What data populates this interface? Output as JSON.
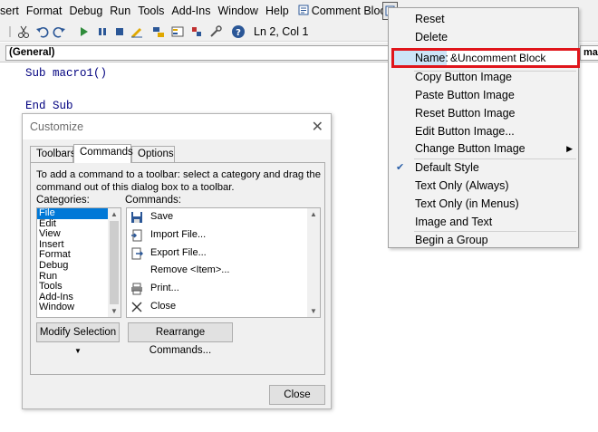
{
  "menubar": {
    "items": [
      "sert",
      "Format",
      "Debug",
      "Run",
      "Tools",
      "Add-Ins",
      "Window",
      "Help"
    ],
    "comment_block": "Comment Block"
  },
  "toolbar": {
    "position": "Ln 2, Col 1"
  },
  "general_combo": "(General)",
  "general_right": "mac",
  "code": {
    "line1": "Sub macro1()",
    "line3": "End Sub"
  },
  "dialog": {
    "title": "Customize",
    "tabs": [
      "Toolbars",
      "Commands",
      "Options"
    ],
    "hint": "To add a command to a toolbar: select a category and drag the command out of this dialog box to a toolbar.",
    "categories_label": "Categories:",
    "commands_label": "Commands:",
    "categories": [
      "File",
      "Edit",
      "View",
      "Insert",
      "Format",
      "Debug",
      "Run",
      "Tools",
      "Add-Ins",
      "Window"
    ],
    "commands": [
      {
        "label": "Save",
        "icon": "save-icon"
      },
      {
        "label": "Import File...",
        "icon": "import-file-icon"
      },
      {
        "label": "Export File...",
        "icon": "export-file-icon"
      },
      {
        "label": "Remove <Item>...",
        "icon": ""
      },
      {
        "label": "Print...",
        "icon": "print-icon"
      },
      {
        "label": "Close",
        "icon": "close-x-icon"
      }
    ],
    "modify_selection": "Modify Selection",
    "rearrange": "Rearrange Commands...",
    "close": "Close"
  },
  "context_menu": {
    "reset": "Reset",
    "delete": "Delete",
    "name_label": "Name:",
    "name_value": "&Uncomment Block",
    "copy_image": "Copy Button Image",
    "paste_image": "Paste Button Image",
    "reset_image": "Reset Button Image",
    "edit_image": "Edit Button Image...",
    "change_image": "Change Button Image",
    "default_style": "Default Style",
    "text_only_always": "Text Only (Always)",
    "text_only_menus": "Text Only (in Menus)",
    "image_and_text": "Image and Text",
    "begin_group": "Begin a Group"
  },
  "colors": {
    "highlight_border": "#e0151b",
    "selection": "#0078d7",
    "keyword": "#00007f"
  }
}
